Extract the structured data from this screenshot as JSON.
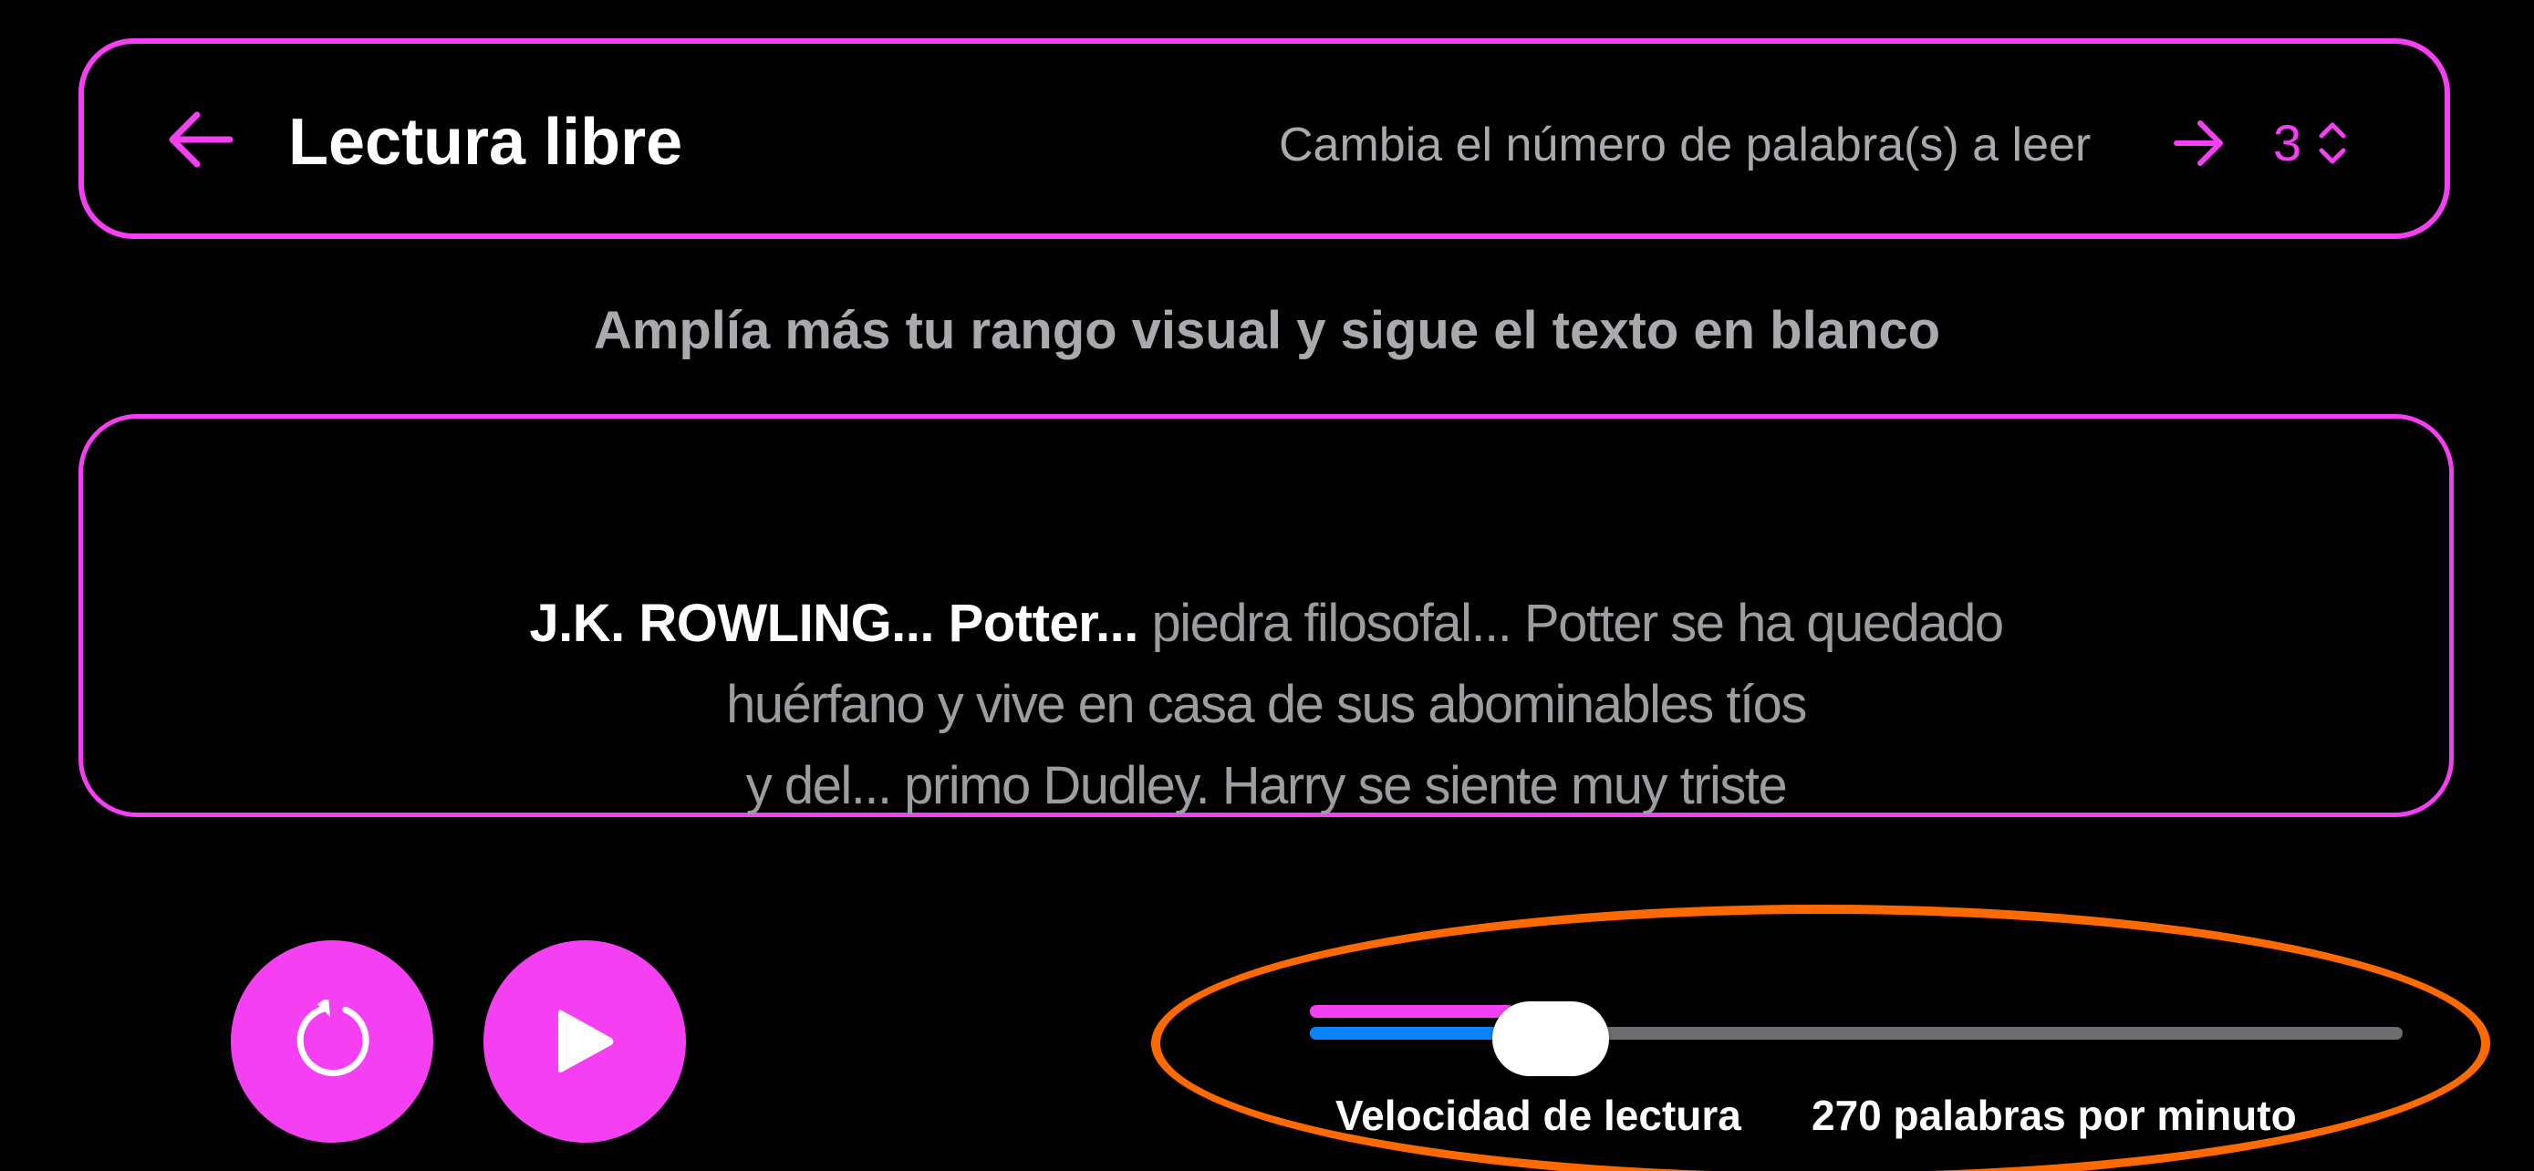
{
  "header": {
    "title": "Lectura libre",
    "hint": "Cambia el número de palabra(s) a leer",
    "word_count": "3"
  },
  "instruction": "Amplía más tu rango visual y sigue el texto en blanco",
  "reading": {
    "lines": [
      {
        "highlighted": "J.K. ROWLING... Potter...",
        "rest": " piedra filosofal... Potter se ha quedado"
      },
      {
        "highlighted": "",
        "rest": "huérfano y vive en casa de sus abominables tíos"
      },
      {
        "highlighted": "",
        "rest": "y del... primo Dudley. Harry se siente muy triste"
      }
    ]
  },
  "controls": {
    "reset_icon": "reset-icon",
    "play_icon": "play-icon"
  },
  "speed": {
    "label": "Velocidad de lectura",
    "value_text": "270 palabras por minuto",
    "level": 0.22
  },
  "colors": {
    "accent": "#F53FF2",
    "highlight_ring": "#FF6A00",
    "slider_blue": "#0A84FF"
  }
}
